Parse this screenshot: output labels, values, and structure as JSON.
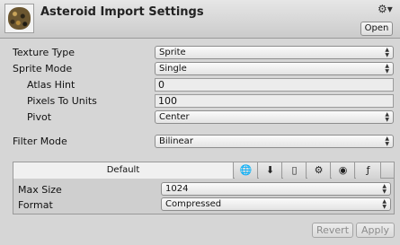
{
  "header": {
    "title": "Asteroid Import Settings",
    "open_label": "Open",
    "gear_icon": "gear-icon"
  },
  "settings": {
    "texture_type_label": "Texture Type",
    "texture_type_value": "Sprite",
    "sprite_mode_label": "Sprite Mode",
    "sprite_mode_value": "Single",
    "atlas_hint_label": "Atlas Hint",
    "atlas_hint_value": "0",
    "pixels_to_units_label": "Pixels To Units",
    "pixels_to_units_value": "100",
    "pivot_label": "Pivot",
    "pivot_value": "Center",
    "filter_mode_label": "Filter Mode",
    "filter_mode_value": "Bilinear"
  },
  "platforms": {
    "default_tab_label": "Default",
    "icons": [
      "globe-icon",
      "download-icon",
      "phone-icon",
      "android-icon",
      "blackberry-icon",
      "flash-icon"
    ],
    "max_size_label": "Max Size",
    "max_size_value": "1024",
    "format_label": "Format",
    "format_value": "Compressed"
  },
  "footer": {
    "revert_label": "Revert",
    "apply_label": "Apply"
  }
}
